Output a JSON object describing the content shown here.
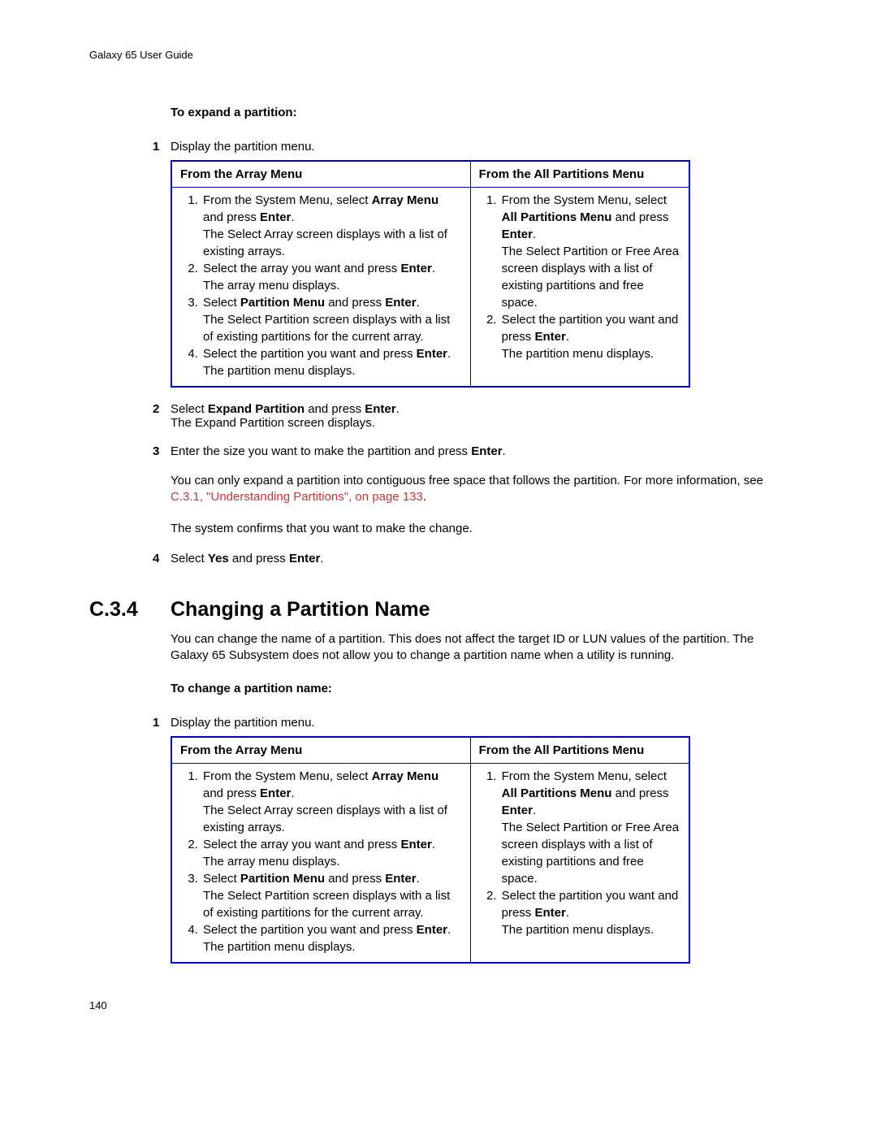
{
  "header": "Galaxy 65 User Guide",
  "pageNumber": "140",
  "proc1": {
    "title": "To expand a partition:",
    "step1": "Display the partition menu.",
    "table": {
      "h1": "From the Array Menu",
      "h2": "From the All Partitions Menu",
      "left": {
        "s1a": "From the System Menu, select ",
        "s1b": "Array Menu",
        "s1c": " and press ",
        "s1d": "Enter",
        "s1e": ".",
        "s1sub": "The Select Array screen displays with a list of existing arrays.",
        "s2a": "Select the array you want and press ",
        "s2b": "Enter",
        "s2c": ".",
        "s2sub": "The array menu displays.",
        "s3a": "Select ",
        "s3b": "Partition Menu",
        "s3c": " and press ",
        "s3d": "Enter",
        "s3e": ".",
        "s3sub": "The Select Partition screen displays with a list of existing partitions for the current array.",
        "s4a": "Select the partition you want and press ",
        "s4b": "Enter",
        "s4c": ".",
        "s4sub": "The partition menu displays."
      },
      "right": {
        "s1a": "From the System Menu, select ",
        "s1b": "All Partitions Menu",
        "s1c": " and press ",
        "s1d": "Enter",
        "s1e": ".",
        "s1sub": "The Select Partition or Free Area screen displays with a list of existing partitions and free space.",
        "s2a": "Select the partition you want and press ",
        "s2b": "Enter",
        "s2c": ".",
        "s2sub": "The partition menu displays."
      }
    },
    "step2a": "Select ",
    "step2b": "Expand Partition",
    "step2c": " and press ",
    "step2d": "Enter",
    "step2e": ".",
    "step2sub": "The Expand Partition screen displays.",
    "step3a": "Enter the size you want to make the partition and press ",
    "step3b": "Enter",
    "step3c": ".",
    "note1": "You can only expand a partition into contiguous free space that follows the partition. For more information, see ",
    "xref": "C.3.1, \"Understanding Partitions\", on page 133",
    "noteEnd": ".",
    "confirm": "The system confirms that you want to make the change.",
    "step4a": "Select ",
    "step4b": "Yes",
    "step4c": " and press ",
    "step4d": "Enter",
    "step4e": "."
  },
  "section": {
    "num": "C.3.4",
    "title": "Changing a Partition Name",
    "intro": "You can change the name of a partition. This does not affect the target ID or LUN values of the partition. The Galaxy 65 Subsystem does not allow you to change a partition name when a utility is running."
  },
  "proc2": {
    "title": "To change a partition name:",
    "step1": "Display the partition menu.",
    "table": {
      "h1": "From the Array Menu",
      "h2": "From the All Partitions Menu",
      "left": {
        "s1a": "From the System Menu, select ",
        "s1b": "Array Menu",
        "s1c": " and press ",
        "s1d": "Enter",
        "s1e": ".",
        "s1sub": "The Select Array screen displays with a list of existing arrays.",
        "s2a": "Select the array you want and press ",
        "s2b": "Enter",
        "s2c": ".",
        "s2sub": "The array menu displays.",
        "s3a": "Select ",
        "s3b": "Partition Menu",
        "s3c": " and press ",
        "s3d": "Enter",
        "s3e": ".",
        "s3sub": "The Select Partition screen displays with a list of existing partitions for the current array.",
        "s4a": "Select the partition you want and press ",
        "s4b": "Enter",
        "s4c": ".",
        "s4sub": "The partition menu displays."
      },
      "right": {
        "s1a": "From the System Menu, select ",
        "s1b": "All Partitions Menu",
        "s1c": " and press ",
        "s1d": "Enter",
        "s1e": ".",
        "s1sub": "The Select Partition or Free Area screen displays with a list of existing partitions and free space.",
        "s2a": "Select the partition you want and press ",
        "s2b": "Enter",
        "s2c": ".",
        "s2sub": "The partition menu displays."
      }
    }
  }
}
